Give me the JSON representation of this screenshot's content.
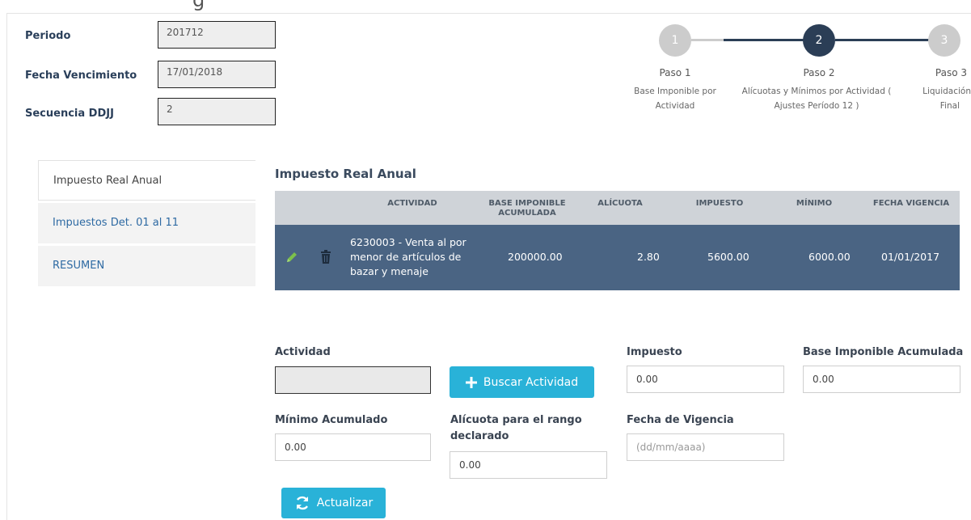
{
  "header": {
    "title_fragment": "g"
  },
  "meta": {
    "periodo_label": "Periodo",
    "periodo_value": "201712",
    "vencimiento_label": "Fecha Vencimiento",
    "vencimiento_value": "17/01/2018",
    "secuencia_label": "Secuencia DDJJ",
    "secuencia_value": "2"
  },
  "stepper": {
    "steps": [
      {
        "number": "1",
        "title": "Paso 1",
        "desc1": "Base Imponible por",
        "desc2": "Actividad",
        "state": "done"
      },
      {
        "number": "2",
        "title": "Paso 2",
        "desc1": "Alícuotas y Mínimos por Actividad (",
        "desc2": "Ajustes Período 12 )",
        "state": "active"
      },
      {
        "number": "3",
        "title": "Paso 3",
        "desc1": "Liquidación",
        "desc2": "Final",
        "state": "pending"
      }
    ],
    "colors": {
      "inactive": "#cccccc",
      "active": "#2b3e56"
    }
  },
  "side_tabs": [
    {
      "label": "Impuesto Real Anual",
      "active": true
    },
    {
      "label": "Impuestos Det. 01 al 11",
      "active": false
    },
    {
      "label": "RESUMEN",
      "active": false
    }
  ],
  "section": {
    "title": "Impuesto Real Anual"
  },
  "table": {
    "headers": {
      "actividad": "ACTIVIDAD",
      "base_line1": "BASE IMPONIBLE",
      "base_line2": "ACUMULADA",
      "alicuota": "ALÍCUOTA",
      "impuesto": "IMPUESTO",
      "minimo": "MÍNIMO",
      "fecha": "FECHA VIGENCIA"
    },
    "row": {
      "actividad_l1": "6230003 - Venta al por",
      "actividad_l2": "menor de artículos de",
      "actividad_l3": "bazar y menaje",
      "base": "200000.00",
      "alicuota": "2.80",
      "impuesto": "5600.00",
      "minimo": "6000.00",
      "fecha": "01/01/2017",
      "edit_icon": "pencil-icon",
      "delete_icon": "trash-icon"
    },
    "colors": {
      "header_bg": "#cfd3d8",
      "row_bg": "#4a6483",
      "edit_icon": "#7cc04b"
    }
  },
  "form": {
    "actividad_label": "Actividad",
    "actividad_value": "",
    "buscar_label": "Buscar Actividad",
    "impuesto_label": "Impuesto",
    "impuesto_value": "0.00",
    "base_label": "Base Imponible Acumulada",
    "base_value": "0.00",
    "minimo_label": "Mínimo Acumulado",
    "minimo_value": "0.00",
    "alicuota_label_l1": "Alícuota para el rango",
    "alicuota_label_l2": "declarado",
    "alicuota_value": "0.00",
    "fecha_label": "Fecha de Vigencia",
    "fecha_placeholder": "(dd/mm/aaaa)",
    "actualizar_label": "Actualizar",
    "button_color": "#29b2d8"
  }
}
